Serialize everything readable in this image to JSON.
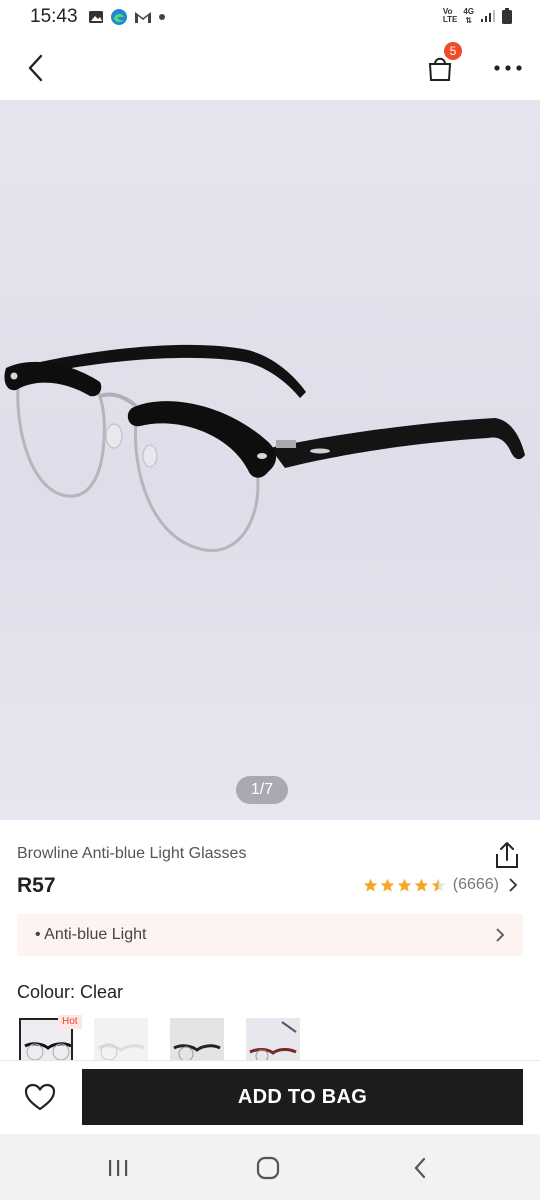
{
  "status_bar": {
    "time": "15:43",
    "left_icons": [
      "gallery-icon",
      "edge-browser-icon",
      "gmail-icon",
      "dot-icon"
    ],
    "network_label_top": "Vo",
    "network_label_bottom": "LTE",
    "network_type": "4G",
    "right_icons": [
      "volte-icon",
      "4g-icon",
      "signal-icon",
      "battery-icon"
    ]
  },
  "top_nav": {
    "back_icon": "chevron-left-icon",
    "bag_icon": "shopping-bag-icon",
    "bag_count": "5",
    "more_icon": "more-dots-icon"
  },
  "gallery": {
    "counter": "1/7",
    "image_subject": "black browline glasses"
  },
  "product": {
    "title": "Browline Anti-blue Light Glasses",
    "price": "R57",
    "rating_value": 4.5,
    "rating_count": "(6666)",
    "feature": "• Anti-blue Light",
    "colour_label": "Colour: Clear"
  },
  "swatches": [
    {
      "name": "clear-black",
      "selected": true,
      "badge": "Hot"
    },
    {
      "name": "transparent",
      "selected": false,
      "badge": ""
    },
    {
      "name": "black-silver",
      "selected": false,
      "badge": ""
    },
    {
      "name": "red-tortoise",
      "selected": false,
      "badge": ""
    }
  ],
  "actions": {
    "add_to_bag": "ADD TO BAG",
    "wishlist_icon": "heart-icon"
  },
  "system_nav": {
    "recents_icon": "recents-icon",
    "home_icon": "home-icon",
    "back_icon": "back-icon"
  },
  "colors": {
    "badge": "#f04b2b",
    "star": "#f6a623",
    "primary_button": "#1c1c1c",
    "feature_bg": "#fdf3f1"
  }
}
